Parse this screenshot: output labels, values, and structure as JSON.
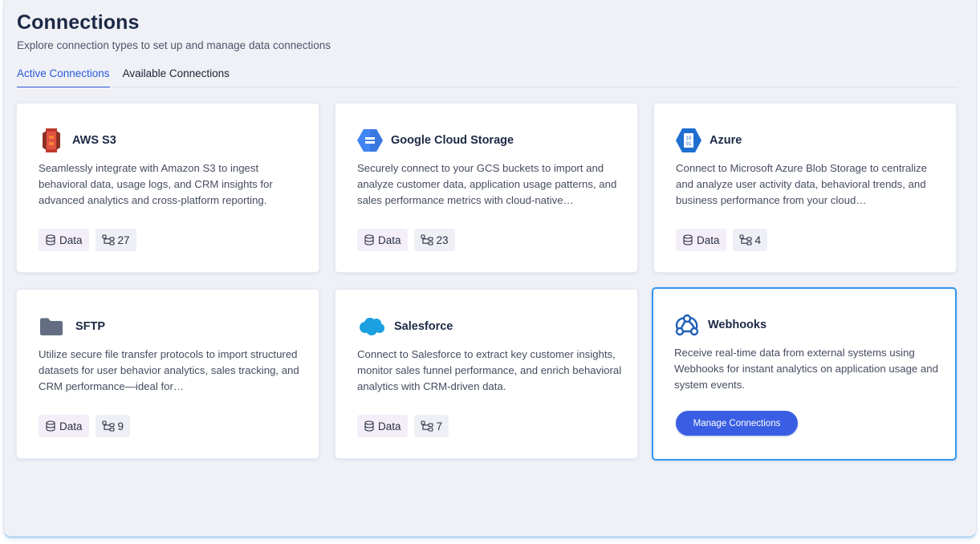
{
  "header": {
    "title": "Connections",
    "subtitle": "Explore connection types to set up and manage data connections"
  },
  "tabs": [
    {
      "label": "Active Connections",
      "active": true
    },
    {
      "label": "Available Connections",
      "active": false
    }
  ],
  "cards": [
    {
      "title": "AWS S3",
      "icon": "aws-s3-icon",
      "description": "Seamlessly integrate with Amazon S3 to ingest behavioral data, usage logs, and CRM insights for advanced analytics and cross-platform reporting.",
      "data_label": "Data",
      "count": "27"
    },
    {
      "title": "Google Cloud Storage",
      "icon": "google-cloud-storage-icon",
      "description": "Securely connect to your GCS buckets to import and analyze customer data, application usage patterns, and sales performance metrics with cloud-native…",
      "data_label": "Data",
      "count": "23"
    },
    {
      "title": "Azure",
      "icon": "azure-icon",
      "description": "Connect to Microsoft Azure Blob Storage to centralize and analyze user activity data, behavioral trends, and business performance from your cloud…",
      "data_label": "Data",
      "count": "4"
    },
    {
      "title": "SFTP",
      "icon": "folder-icon",
      "description": "Utilize secure file transfer protocols to import structured datasets for user behavior analytics, sales tracking, and CRM performance—ideal for…",
      "data_label": "Data",
      "count": "9"
    },
    {
      "title": "Salesforce",
      "icon": "salesforce-cloud-icon",
      "description": "Connect to Salesforce to extract key customer insights, monitor sales funnel performance, and enrich behavioral analytics with CRM-driven data.",
      "data_label": "Data",
      "count": "7"
    },
    {
      "title": "Webhooks",
      "icon": "webhook-icon",
      "description": "Receive real-time data from external systems using Webhooks for instant analytics on application usage and system events.",
      "button_label": "Manage Connections"
    }
  ],
  "colors": {
    "accent": "#2b59d6",
    "button": "#3a5ee3",
    "selected_border": "#3395ec"
  }
}
